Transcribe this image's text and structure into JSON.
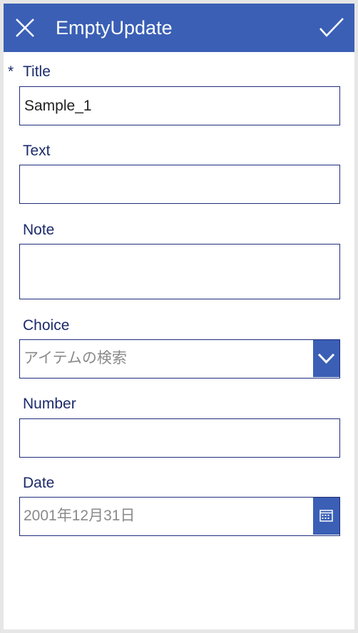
{
  "header": {
    "title": "EmptyUpdate"
  },
  "form": {
    "title_field": {
      "label": "Title",
      "required_marker": "*",
      "value": "Sample_1"
    },
    "text_field": {
      "label": "Text",
      "value": ""
    },
    "note_field": {
      "label": "Note",
      "value": ""
    },
    "choice_field": {
      "label": "Choice",
      "placeholder": "アイテムの検索"
    },
    "number_field": {
      "label": "Number",
      "value": ""
    },
    "date_field": {
      "label": "Date",
      "placeholder": "2001年12月31日"
    }
  },
  "colors": {
    "header_bg": "#3a5fb5",
    "label_text": "#1b2a6b",
    "input_border": "#1f2d7a",
    "placeholder": "#8a8a8a"
  },
  "icons": {
    "close": "close-icon",
    "confirm": "checkmark-icon",
    "dropdown": "chevron-down-icon",
    "calendar": "calendar-icon"
  }
}
